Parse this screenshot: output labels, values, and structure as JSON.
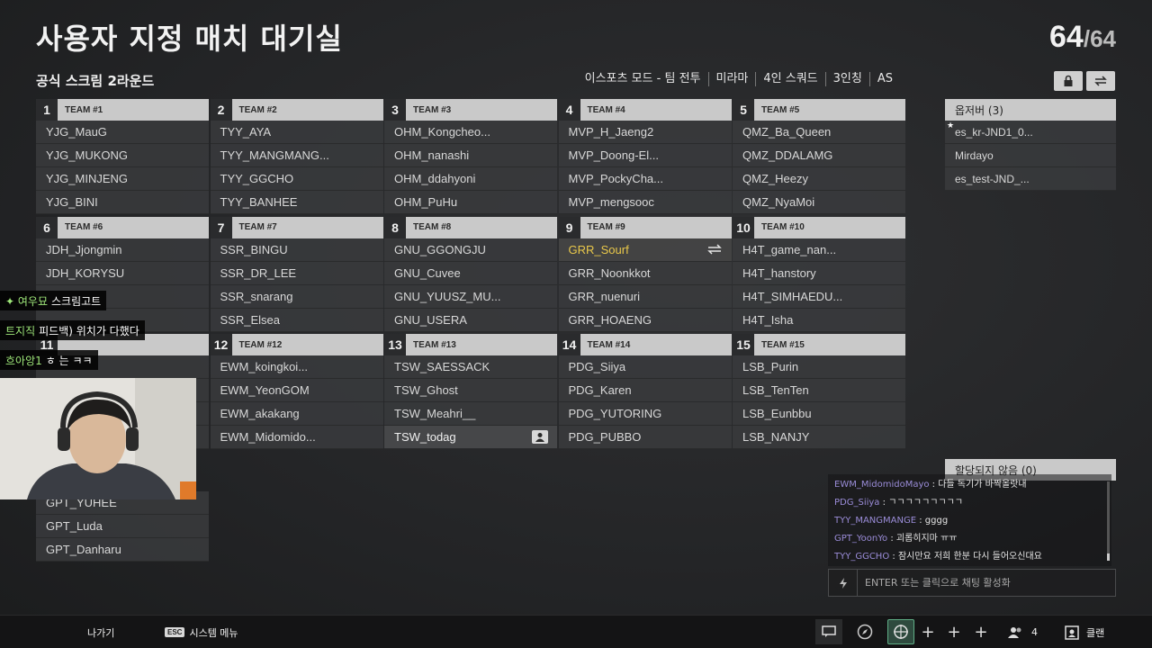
{
  "header": {
    "title": "사용자 지정 매치 대기실",
    "count_current": "64",
    "count_sep": "/",
    "count_max": "64",
    "subtitle": "공식 스크림 2라운드",
    "mode_info": [
      "이스포츠 모드 - 팀 전투",
      "미라마",
      "4인 스쿼드",
      "3인칭",
      "AS"
    ],
    "lock_icon": "lock-icon",
    "swap_icon": "swap-icon"
  },
  "teams": [
    {
      "num": "1",
      "name": "TEAM #1",
      "players": [
        "YJG_MauG",
        "YJG_MUKONG",
        "YJG_MINJENG",
        "YJG_BINI"
      ]
    },
    {
      "num": "2",
      "name": "TEAM #2",
      "players": [
        "TYY_AYA",
        "TYY_MANGMANG...",
        "TYY_GGCHO",
        "TYY_BANHEE"
      ]
    },
    {
      "num": "3",
      "name": "TEAM #3",
      "players": [
        "OHM_Kongcheo...",
        "OHM_nanashi",
        "OHM_ddahyoni",
        "OHM_PuHu"
      ]
    },
    {
      "num": "4",
      "name": "TEAM #4",
      "players": [
        "MVP_H_Jaeng2",
        "MVP_Doong-El...",
        "MVP_PockyCha...",
        "MVP_mengsooc"
      ]
    },
    {
      "num": "5",
      "name": "TEAM #5",
      "players": [
        "QMZ_Ba_Queen",
        "QMZ_DDALAMG",
        "QMZ_Heezy",
        "QMZ_NyaMoi"
      ]
    },
    {
      "num": "6",
      "name": "TEAM #6",
      "players": [
        "JDH_Jjongmin",
        "JDH_KORYSU",
        "",
        ""
      ]
    },
    {
      "num": "7",
      "name": "TEAM #7",
      "players": [
        "SSR_BINGU",
        "SSR_DR_LEE",
        "SSR_snarang",
        "SSR_Elsea"
      ]
    },
    {
      "num": "8",
      "name": "TEAM #8",
      "players": [
        "GNU_GGONGJU",
        "GNU_Cuvee",
        "GNU_YUUSZ_MU...",
        "GNU_USERA"
      ]
    },
    {
      "num": "9",
      "name": "TEAM #9",
      "players": [
        "GRR_Sourf",
        "GRR_Noonkkot",
        "GRR_nuenuri",
        "GRR_HOAENG"
      ]
    },
    {
      "num": "10",
      "name": "TEAM #10",
      "players": [
        "H4T_game_nan...",
        "H4T_hanstory",
        "H4T_SIMHAEDU...",
        "H4T_Isha"
      ]
    },
    {
      "num": "11",
      "name": "",
      "players": [
        "",
        "",
        "",
        ""
      ]
    },
    {
      "num": "12",
      "name": "TEAM #12",
      "players": [
        "EWM_koingkoi...",
        "EWM_YeonGOM",
        "EWM_akakang",
        "EWM_Midomido..."
      ]
    },
    {
      "num": "13",
      "name": "TEAM #13",
      "players": [
        "TSW_SAESSACK",
        "TSW_Ghost",
        "TSW_Meahri__",
        "TSW_todag"
      ]
    },
    {
      "num": "14",
      "name": "TEAM #14",
      "players": [
        "PDG_Siiya",
        "PDG_Karen",
        "PDG_YUTORING",
        "PDG_PUBBO"
      ]
    },
    {
      "num": "15",
      "name": "TEAM #15",
      "players": [
        "LSB_Purin",
        "LSB_TenTen",
        "LSB_Eunbbu",
        "LSB_NANJY"
      ]
    },
    {
      "num": "",
      "name": "",
      "players": [
        "",
        "GPT_YUHEE",
        "GPT_Luda",
        "GPT_Danharu"
      ]
    }
  ],
  "observers": {
    "header": "옵저버 (3)",
    "items": [
      "es_kr-JND1_0...",
      "Mirdayo",
      "es_test-JND_..."
    ]
  },
  "unassigned": {
    "header": "할당되지 않음 (0)"
  },
  "chat": {
    "lines": [
      {
        "who": "EWM_MidomidoMayo",
        "msg": "다들 독기가 바짝올랏내"
      },
      {
        "who": "PDG_Siiya",
        "msg": "ㄱㄱㄱㄱㄱㄱㄱㄱㄱ"
      },
      {
        "who": "TYY_MANGMANGE",
        "msg": "gggg"
      },
      {
        "who": "GPT_YoonYo",
        "msg": "괴롭히지마 ㅠㅠ"
      },
      {
        "who": "TYY_GGCHO",
        "msg": "잠시만요 저희 한분 다시 들어오신대요"
      }
    ],
    "sep": " : ",
    "input_placeholder": "ENTER 또는 클릭으로 채팅 활성화"
  },
  "stream_overlay": [
    {
      "prefix": "✦ 여우묘",
      "text": "스크림고트"
    },
    {
      "prefix": "트지직",
      "text": "피드백) 위치가 다했다"
    },
    {
      "prefix": "흐아앙1",
      "text": "ㅎ 는 ㅋㅋ"
    }
  ],
  "bottom": {
    "leave": "나가기",
    "esc_key": "ESC",
    "system_menu": "시스템 메뉴",
    "party_count": "4",
    "clan": "클랜"
  },
  "colors": {
    "selected_player": "#e9c84a",
    "chat_name": "#9a8cd8",
    "overlay_highlight": "#9fe87a"
  }
}
